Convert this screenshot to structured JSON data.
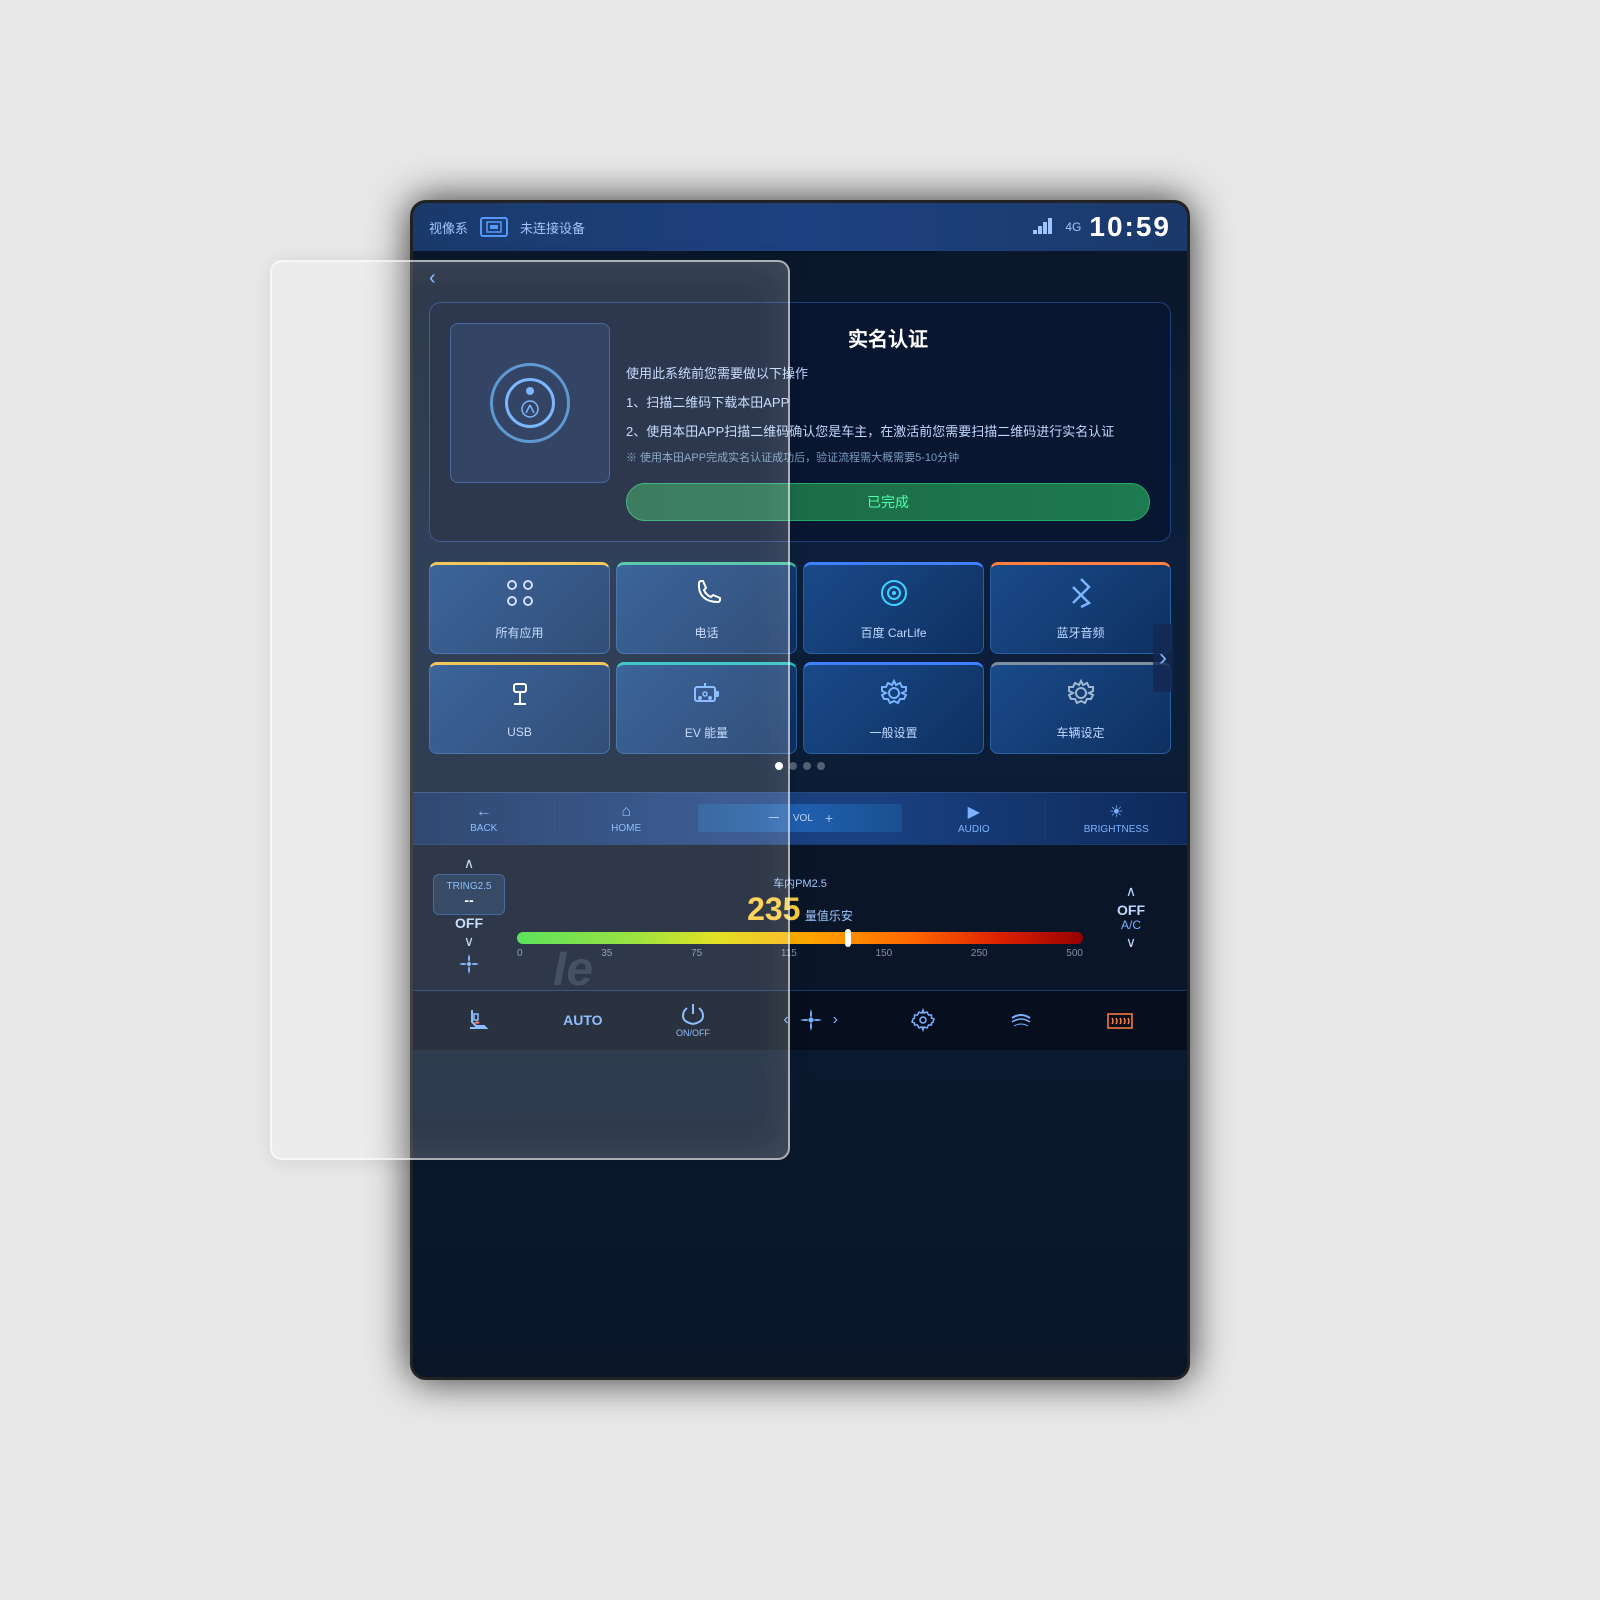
{
  "status_bar": {
    "left_label": "视像系",
    "device_text": "未连接设备",
    "signal_text": "4G",
    "time": "10:59"
  },
  "dialog": {
    "title": "实名认证",
    "instruction": "使用此系统前您需要做以下操作",
    "step1": "1、扫描二维码下载本田APP",
    "step2": "2、使用本田APP扫描二维码确认您是车主，在激活前您需要扫描二维码进行实名认证",
    "note": "※ 使用本田APP完成实名认证成功后，验证流程需大概需要5-10分钟",
    "completed_btn": "已完成"
  },
  "apps": {
    "row1": [
      {
        "label": "所有应用",
        "accent": "yellow"
      },
      {
        "label": "电话",
        "accent": "green"
      },
      {
        "label": "百度 CarLife",
        "accent": "blue"
      },
      {
        "label": "蓝牙音频",
        "accent": "orange"
      }
    ],
    "row2": [
      {
        "label": "USB",
        "accent": "yellow"
      },
      {
        "label": "EV 能量",
        "accent": "teal"
      },
      {
        "label": "一般设置",
        "accent": "blue"
      },
      {
        "label": "车辆设定",
        "accent": "gray"
      }
    ]
  },
  "nav_bar": {
    "back_label": "BACK",
    "home_label": "HOME",
    "vol_minus": "－",
    "vol_label": "VOL",
    "vol_plus": "+",
    "audio_label": "AUDIO",
    "brightness_label": "BRIGHTNESS"
  },
  "climate": {
    "left_temp": "--",
    "left_label": "TRING2.5",
    "left_off": "OFF",
    "pm25_label": "车内PM2.5",
    "pm25_value": "235",
    "pm25_unit": "量值乐安",
    "scale": [
      "0",
      "35",
      "75",
      "115",
      "150",
      "250",
      "500"
    ],
    "right_off": "OFF",
    "right_label": "A/C"
  },
  "bottom_controls": {
    "seat_heat_label": "",
    "auto_label": "AUTO",
    "onoff_label": "ON/OFF",
    "fan_label": "",
    "settings_label": "",
    "ac_label": "",
    "defrost_label": ""
  },
  "ie_text": "Ie"
}
